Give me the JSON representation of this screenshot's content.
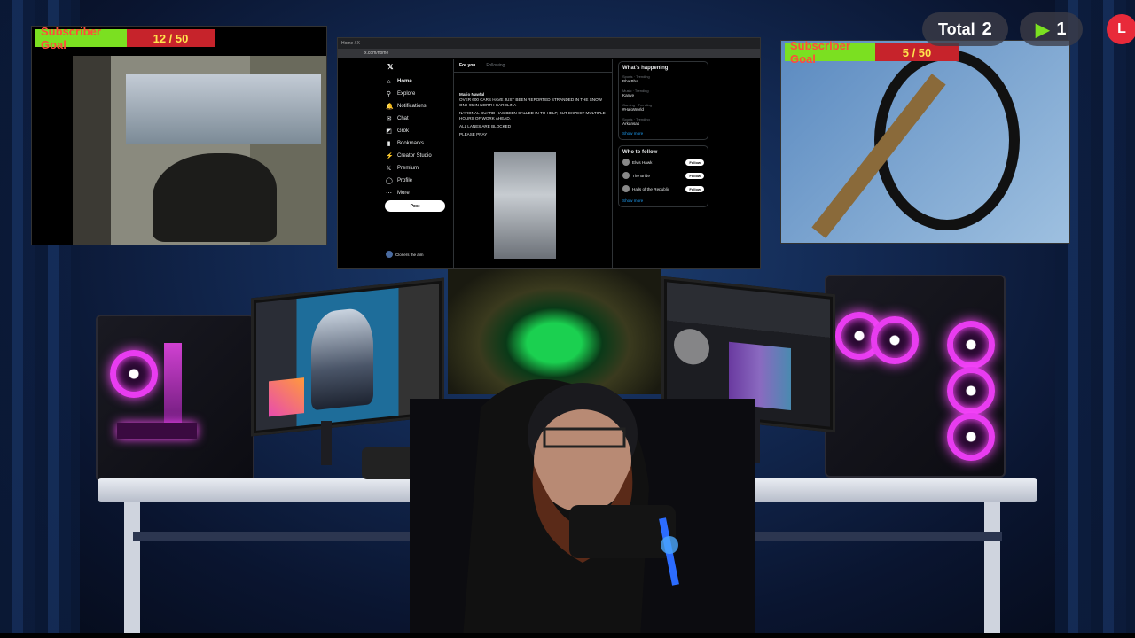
{
  "overlays": {
    "left_goal": {
      "label": "Subscriber Goal",
      "progress": "12 / 50",
      "value": 12,
      "max": 50
    },
    "right_goal": {
      "label": "Subscriber Goal",
      "progress": "5 / 50",
      "value": 5,
      "max": 50
    },
    "total_counter": {
      "label": "Total",
      "value": "2"
    },
    "play_counter": {
      "value": "1"
    },
    "rec_badge": {
      "label": "L"
    }
  },
  "browser": {
    "tab_title": "Home / X",
    "url": "x.com/home",
    "nav": [
      {
        "icon": "home-icon",
        "glyph": "⌂",
        "label": "Home"
      },
      {
        "icon": "search-icon",
        "glyph": "⚲",
        "label": "Explore"
      },
      {
        "icon": "bell-icon",
        "glyph": "🔔",
        "label": "Notifications"
      },
      {
        "icon": "chat-icon",
        "glyph": "✉",
        "label": "Chat"
      },
      {
        "icon": "grok-icon",
        "glyph": "◩",
        "label": "Grok"
      },
      {
        "icon": "bookmark-icon",
        "glyph": "▮",
        "label": "Bookmarks"
      },
      {
        "icon": "lightning-icon",
        "glyph": "⚡",
        "label": "Creator Studio"
      },
      {
        "icon": "x-icon",
        "glyph": "𝕏",
        "label": "Premium"
      },
      {
        "icon": "person-icon",
        "glyph": "◯",
        "label": "Profile"
      },
      {
        "icon": "more-icon",
        "glyph": "⋯",
        "label": "More"
      }
    ],
    "post_button": "Post",
    "tabs": [
      "For you",
      "Following"
    ],
    "tweet": {
      "author": "Mario Nawfal",
      "body": "OVER 600 CARS HAVE JUST BEEN REPORTED STRANDED IN THE SNOW ON I-95 IN NORTH CAROLINA",
      "line2": "NATIONAL GUARD HAS BEEN CALLED IN TO HELP, BUT EXPECT MULTIPLE HOURS OF WORK AHEAD.",
      "line3": "ALL LANES ARE BLOCKED",
      "line4": "PLEASE PRAY"
    },
    "sidebar": {
      "happening_title": "What's happening",
      "trends": [
        {
          "context": "Sports · Trending",
          "name": "Bha Bha"
        },
        {
          "context": "Music · Trending",
          "name": "Kanye"
        },
        {
          "context": "Gaming · Trending",
          "name": "#HaloWorld"
        },
        {
          "context": "Sports · Trending",
          "name": "Arkansas"
        }
      ],
      "show_more": "Show more",
      "follow_title": "Who to follow",
      "follow": [
        {
          "name": "Elvis Hawk",
          "follow": "Follow"
        },
        {
          "name": "The Bride",
          "follow": "Follow"
        },
        {
          "name": "Halls of the Republic",
          "follow": "Follow"
        }
      ],
      "show_more2": "Show more"
    },
    "account": "Cloners the aim"
  },
  "colors": {
    "goal_fill": "#7be021",
    "goal_rest": "#c6232b",
    "fan_glow": "#e83cf0",
    "rec": "#e82a3a"
  }
}
